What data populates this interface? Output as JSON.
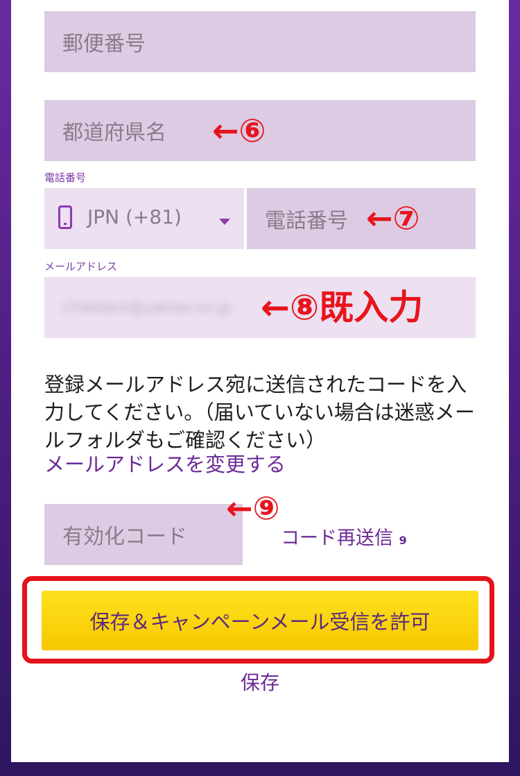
{
  "form": {
    "postal_code_placeholder": "郵便番号",
    "prefecture_placeholder": "都道府県名",
    "phone_label": "電話番号",
    "country_code": "JPN (+81)",
    "phone_placeholder": "電話番号",
    "email_label": "メールアドレス",
    "email_value": "chibitaro@yahoo.co.jp",
    "description": "登録メールアドレス宛に送信されたコードを入力してください。（届いていない場合は迷惑メールフォルダもご確認ください）",
    "change_email_link": "メールアドレスを変更する",
    "activation_code_placeholder": "有効化コード",
    "resend_code_label": "コード再送信",
    "resend_countdown": "9",
    "primary_button_label": "保存＆キャンペーンメール受信を許可",
    "save_link": "保存"
  },
  "annotations": {
    "marker_6": "←⑥",
    "marker_7": "←⑦",
    "marker_8": "←⑧既入力",
    "marker_9": "←⑨"
  },
  "colors": {
    "field_bg": "#dccbe3",
    "accent_purple": "#6a2a96",
    "button_yellow": "#f7c800",
    "annotation_red": "#e8141c"
  },
  "icons": {
    "phone": "mobile-phone-icon",
    "dropdown": "caret-down-icon"
  }
}
